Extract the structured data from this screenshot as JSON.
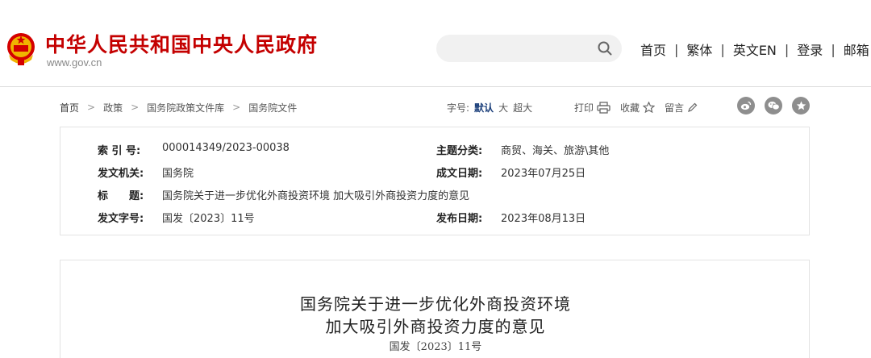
{
  "header": {
    "site_title": "中华人民共和国中央人民政府",
    "site_url": "www.gov.cn",
    "search": {
      "placeholder": ""
    },
    "nav": [
      "首页",
      "繁体",
      "英文EN",
      "登录",
      "邮箱"
    ],
    "nav_separator": "|"
  },
  "breadcrumb": {
    "items": [
      "首页",
      "政策",
      "国务院政策文件库",
      "国务院文件"
    ],
    "separator": ">"
  },
  "font_size": {
    "label": "字号:",
    "options": [
      "默认",
      "大",
      "超大"
    ],
    "active": "默认"
  },
  "tools": {
    "print": "打印",
    "favorite": "收藏",
    "comment": "留言"
  },
  "share_icons": [
    "weibo-icon",
    "wechat-icon",
    "star-icon"
  ],
  "info": {
    "index_label": "索 引 号:",
    "index_value": "000014349/2023-00038",
    "topic_label": "主题分类:",
    "topic_value": "商贸、海关、旅游\\其他",
    "issuer_label": "发文机关:",
    "issuer_value": "国务院",
    "written_label": "成文日期:",
    "written_value": "2023年07月25日",
    "title_label": "标　　题:",
    "title_value": "国务院关于进一步优化外商投资环境 加大吸引外商投资力度的意见",
    "docno_label": "发文字号:",
    "docno_value": "国发〔2023〕11号",
    "published_label": "发布日期:",
    "published_value": "2023年08月13日"
  },
  "article": {
    "title_line1": "国务院关于进一步优化外商投资环境",
    "title_line2": "加大吸引外商投资力度的意见",
    "doc_number": "国发〔2023〕11号"
  },
  "colors": {
    "brand_red": "#c40000",
    "active_blue": "#1a3e7a",
    "icon_gray": "#8e8e8e"
  }
}
